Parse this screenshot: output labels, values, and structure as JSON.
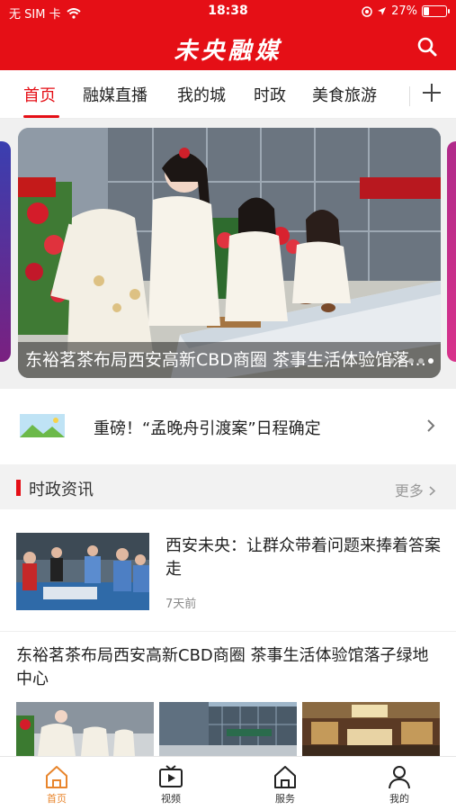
{
  "status_bar": {
    "carrier": "无 SIM 卡",
    "time": "18:38",
    "battery": "27%",
    "battery_level": 0.27
  },
  "app": {
    "logo": "未央融媒"
  },
  "tabs": {
    "items": [
      "首页",
      "融媒直播",
      "我的城",
      "时政",
      "美食旅游"
    ],
    "active": "首页"
  },
  "carousel": {
    "caption": "东裕茗茶布局西安高新CBD商圈 茶事生活体验馆落子绿地中心",
    "slide_count": 5,
    "active_index": 4
  },
  "notice": {
    "text": "重磅！“孟晚舟引渡案”日程确定"
  },
  "section": {
    "title": "时政资讯",
    "more": "更多"
  },
  "news": [
    {
      "title": "西安未央：让群众带着问题来捧着答案走",
      "time": "7天前"
    },
    {
      "title": "东裕茗茶布局西安高新CBD商圈 茶事生活体验馆落子绿地中心"
    }
  ],
  "bottom_nav": {
    "items": [
      "首页",
      "视频",
      "服务",
      "我的"
    ],
    "active": "首页"
  },
  "colors": {
    "brand_red": "#e50f16",
    "active_orange": "#e8852c"
  },
  "icons": [
    "wifi-icon",
    "location-icon",
    "search-icon",
    "plus-icon",
    "landscape-icon",
    "chevron-right-icon",
    "home-icon",
    "video-icon",
    "service-icon",
    "person-icon"
  ]
}
